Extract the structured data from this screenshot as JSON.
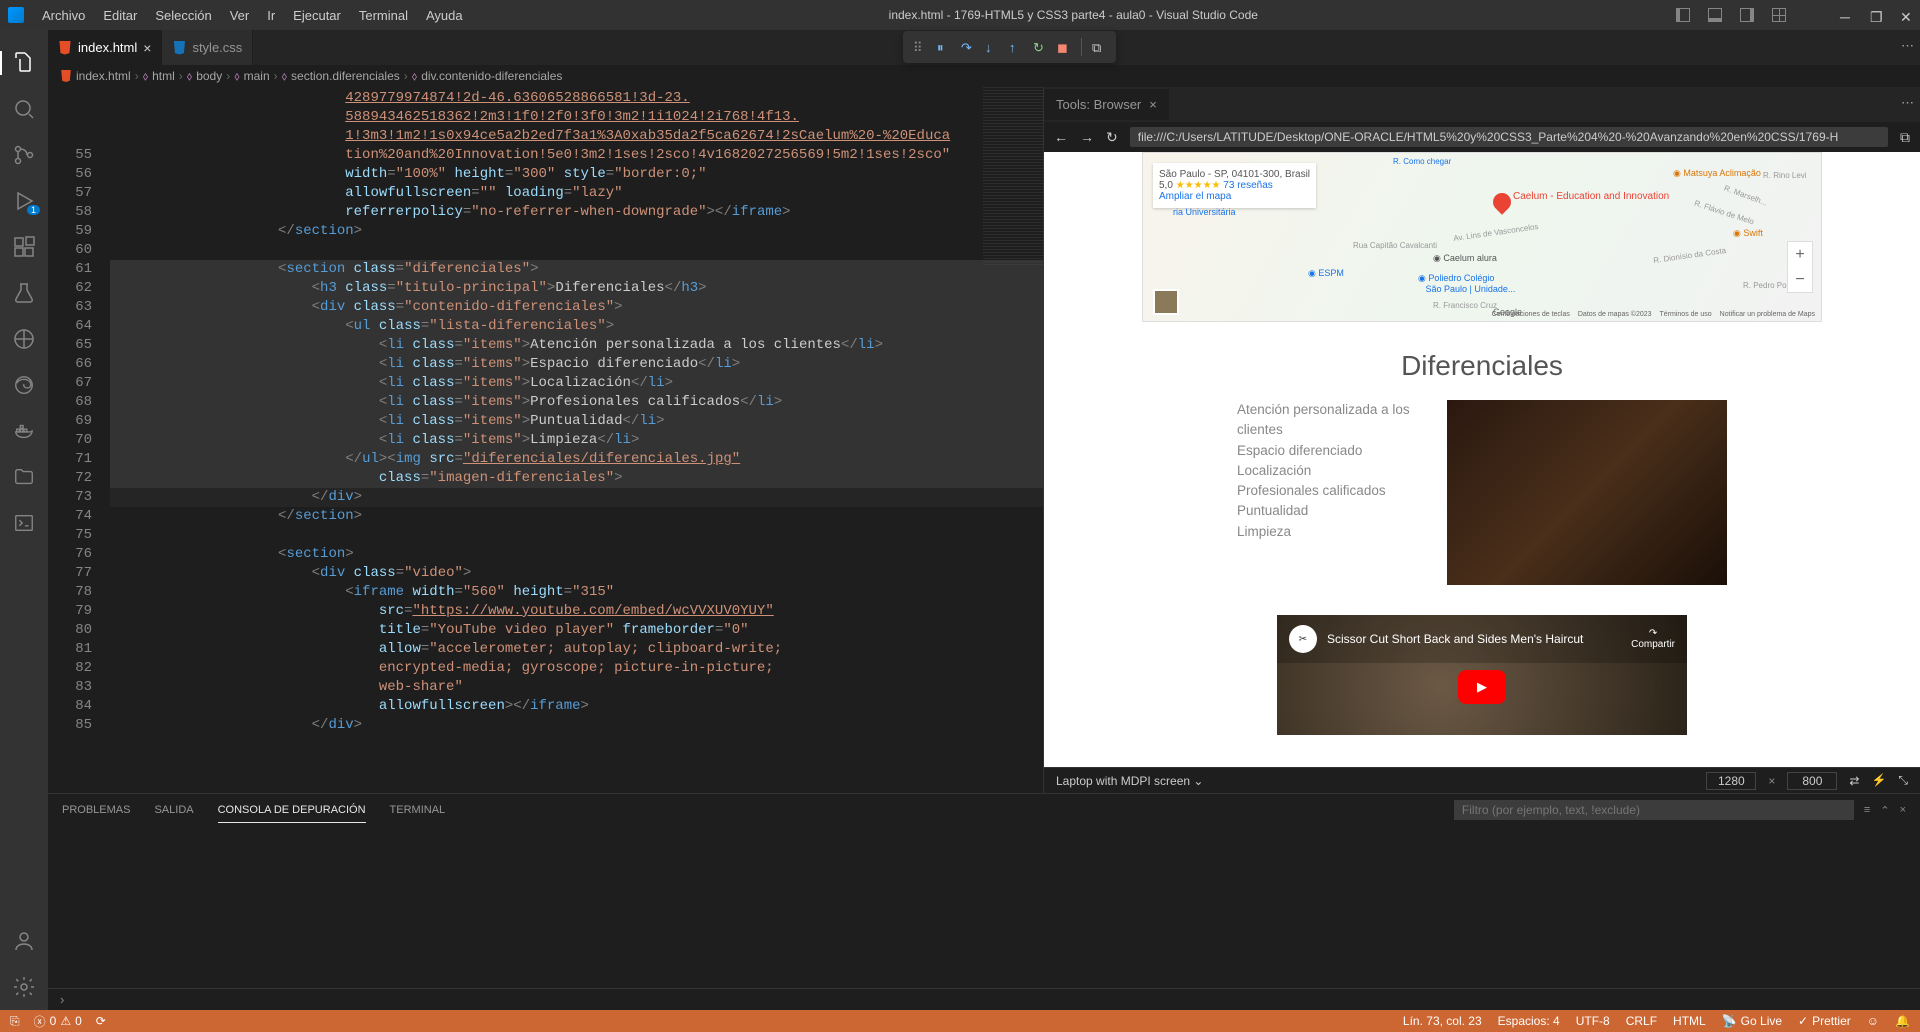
{
  "window": {
    "title": "index.html - 1769-HTML5 y CSS3 parte4 - aula0 - Visual Studio Code"
  },
  "menu": {
    "archivo": "Archivo",
    "editar": "Editar",
    "seleccion": "Selección",
    "ver": "Ver",
    "ir": "Ir",
    "ejecutar": "Ejecutar",
    "terminal": "Terminal",
    "ayuda": "Ayuda"
  },
  "activity": {
    "run_badge": "1"
  },
  "tabs": {
    "index": "index.html",
    "style": "style.css"
  },
  "browser": {
    "tab": "Tools: Browser",
    "url": "file:///C:/Users/LATITUDE/Desktop/ONE-ORACLE/HTML5%20y%20CSS3_Parte%204%20-%20Avanzando%20en%20CSS/1769-H"
  },
  "breadcrumbs": {
    "file": "index.html",
    "html": "html",
    "body": "body",
    "main": "main",
    "section": "section.diferenciales",
    "div": "div.contenido-diferenciales"
  },
  "gutter_lines": [
    "",
    "",
    "",
    "55",
    "56",
    "57",
    "58",
    "59",
    "60",
    "61",
    "62",
    "63",
    "64",
    "65",
    "66",
    "67",
    "68",
    "69",
    "70",
    "71",
    "72",
    "73",
    "74",
    "75",
    "76",
    "77",
    "78",
    "79",
    "80",
    "81",
    "82",
    "83",
    "84",
    "85"
  ],
  "code": {
    "l1": "4289779974874!2d-46.63606528866581!3d-23.",
    "l2": "588943462518362!2m3!1f0!2f0!3f0!3m2!1i1024!2i768!4f13.",
    "l3": "1!3m3!1m2!1s0x94ce5a2b2ed7f3a1%3A0xab35da2f5ca62674!2sCaelum%20-%20Educa",
    "l4": "tion%20and%20Innovation!5e0!3m2!1ses!2sco!4v1682027256569!5m2!1ses!2sco",
    "l5a": "width",
    "l5b": "\"100%\"",
    "l5c": "height",
    "l5d": "\"300\"",
    "l5e": "style",
    "l5f": "\"border:0;\"",
    "l6a": "allowfullscreen",
    "l6b": "\"\"",
    "l6c": "loading",
    "l6d": "\"lazy\"",
    "l7a": "referrerpolicy",
    "l7b": "\"no-referrer-when-downgrade\"",
    "l7c": "iframe",
    "l8": "section",
    "l10a": "section",
    "l10b": "class",
    "l10c": "\"diferenciales\"",
    "l11a": "h3",
    "l11b": "class",
    "l11c": "\"titulo-principal\"",
    "l11d": "Diferenciales",
    "l11e": "h3",
    "l12a": "div",
    "l12b": "class",
    "l12c": "\"contenido-diferenciales\"",
    "l13a": "ul",
    "l13b": "class",
    "l13c": "\"lista-diferenciales\"",
    "l14a": "li",
    "l14b": "class",
    "l14c": "\"items\"",
    "l14d": "Atención personalizada a los clientes",
    "l14e": "li",
    "l15d": "Espacio diferenciado",
    "l16d": "Localización",
    "l17d": "Profesionales calificados",
    "l18d": "Puntualidad",
    "l19d": "Limpieza",
    "l20a": "ul",
    "l20b": "img",
    "l20c": "src",
    "l20d": "\"diferenciales/diferenciales.jpg\"",
    "l21a": "class",
    "l21b": "\"imagen-diferenciales\"",
    "l22": "div",
    "l23": "section",
    "l25": "section",
    "l26a": "div",
    "l26b": "class",
    "l26c": "\"video\"",
    "l27a": "iframe",
    "l27b": "width",
    "l27c": "\"560\"",
    "l27d": "height",
    "l27e": "\"315\"",
    "l28a": "src",
    "l28b": "\"https://www.youtube.com/embed/wcVVXUV0YUY\"",
    "l29a": "title",
    "l29b": "\"YouTube video player\"",
    "l29c": "frameborder",
    "l29d": "\"0\"",
    "l30a": "allow",
    "l30b": "\"accelerometer; autoplay; clipboard-write;",
    "l31": "encrypted-media; gyroscope; picture-in-picture;",
    "l32": "web-share\"",
    "l33a": "allowfullscreen",
    "l33b": "iframe",
    "l34": "div"
  },
  "preview": {
    "map_addr": "São Paulo - SP, 04101-300, Brasil",
    "map_rating": "5,0",
    "map_reviews": "73 reseñas",
    "map_amp": "Ampliar el mapa",
    "pin_label": "Caelum - Education and Innovation",
    "poi_matsuya": "Matsuya Aclimação",
    "poi_swift": "Swift",
    "poi_caelum": "Caelum alura",
    "poi_poliedro1": "Poliedro Colégio",
    "poi_poliedro2": "São Paulo | Unidade...",
    "poi_espm": "ESPM",
    "poi_univ": "ria Universitária",
    "road1": "Av. Lins de Vasconcelos",
    "road2": "Rua Capitão Cavalcanti",
    "road3": "R. Francisco Cruz",
    "road4": "R. Dionísio da Costa",
    "road5": "R. Flávio de Melo",
    "road6": "R. Rino Levi",
    "road7": "R. Marselh...",
    "road8": "R. Pedro Por...",
    "road9": "R. Como chegar",
    "footer1": "Combinaciones de teclas",
    "footer2": "Datos de mapas ©2023",
    "footer3": "Términos de uso",
    "footer4": "Notificar un problema de Maps",
    "google": "Google",
    "title": "Diferenciales",
    "items": [
      "Atención personalizada a los clientes",
      "Espacio diferenciado",
      "Localización",
      "Profesionales calificados",
      "Puntualidad",
      "Limpieza"
    ],
    "video_title": "Scissor Cut Short Back and Sides Men's Haircut",
    "video_share": "Compartir"
  },
  "devstatus": {
    "device": "Laptop with MDPI screen",
    "w": "1280",
    "h": "800"
  },
  "panel": {
    "problemas": "PROBLEMAS",
    "salida": "SALIDA",
    "consola": "CONSOLA DE DEPURACIÓN",
    "terminal": "TERMINAL",
    "filter_ph": "Filtro (por ejemplo, text, !exclude)"
  },
  "status": {
    "errors": "0",
    "warnings": "0",
    "line_col": "Lín. 73, col. 23",
    "spaces": "Espacios: 4",
    "encoding": "UTF-8",
    "eol": "CRLF",
    "lang": "HTML",
    "golive": "Go Live",
    "prettier": "Prettier"
  }
}
